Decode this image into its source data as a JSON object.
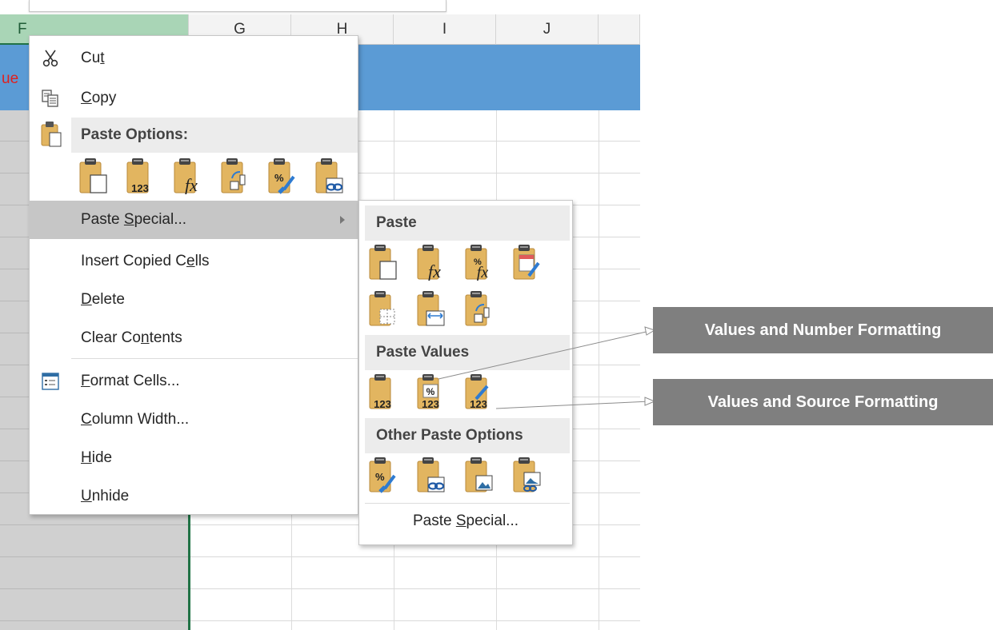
{
  "sheet": {
    "columns": [
      "F",
      "G",
      "H",
      "I",
      "J"
    ],
    "header_fragment": "ue"
  },
  "context_menu": {
    "items": [
      {
        "id": "cut",
        "label": "Cut",
        "icon": "scissors-icon"
      },
      {
        "id": "copy",
        "label": "Copy",
        "icon": "copy-icon"
      }
    ],
    "paste_options_header": "Paste Options:",
    "paste_option_icons": [
      "paste-icon",
      "paste-values-icon",
      "paste-formulas-icon",
      "paste-transpose-icon",
      "paste-formatting-icon",
      "paste-link-icon"
    ],
    "paste_special": "Paste Special...",
    "insert_copied_cells": "Insert Copied Cells",
    "delete": "Delete",
    "clear_contents": "Clear Contents",
    "format_cells": "Format Cells...",
    "column_width": "Column Width...",
    "hide": "Hide",
    "unhide": "Unhide"
  },
  "submenu": {
    "paste_header": "Paste",
    "paste_icons": [
      "paste-icon",
      "paste-formulas-icon",
      "paste-formulas-number-formatting-icon",
      "paste-keep-source-formatting-icon",
      "paste-no-borders-icon",
      "paste-keep-column-widths-icon",
      "paste-transpose-icon"
    ],
    "paste_values_header": "Paste Values",
    "paste_values_icons": [
      "values-icon",
      "values-number-formatting-icon",
      "values-source-formatting-icon"
    ],
    "other_header": "Other Paste Options",
    "other_icons": [
      "paste-formatting-icon",
      "paste-link-icon",
      "paste-picture-icon",
      "paste-linked-picture-icon"
    ],
    "footer": "Paste Special..."
  },
  "callouts": [
    {
      "text": "Values and Number Formatting"
    },
    {
      "text": "Values and Source Formatting"
    }
  ],
  "colors": {
    "header_blue": "#5b9bd5",
    "selected_col": "#a9d5b6",
    "callout_gray": "#7f7f7f",
    "clipboard_tan": "#e2b560"
  }
}
